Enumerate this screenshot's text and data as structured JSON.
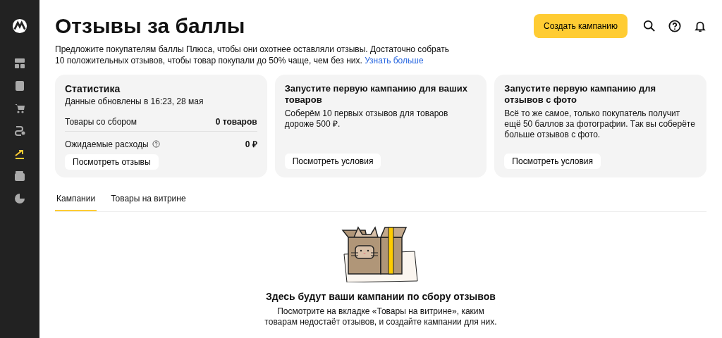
{
  "sidebar": {
    "items": [
      {
        "kind": "dashboard",
        "selected": false
      },
      {
        "kind": "box",
        "selected": false
      },
      {
        "kind": "cart",
        "selected": false
      },
      {
        "kind": "route",
        "selected": false
      },
      {
        "kind": "trend",
        "selected": true
      },
      {
        "kind": "wallet",
        "selected": false
      },
      {
        "kind": "pie",
        "selected": false
      }
    ]
  },
  "header": {
    "title": "Отзывы за баллы",
    "create_button": "Создать кампанию"
  },
  "intro": {
    "text": "Предложите покупателям баллы Плюса, чтобы они охотнее оставляли отзывы. Достаточно собрать 10 положительных отзывов, чтобы товар покупали до 50% чаще, чем без них.",
    "link": "Узнать больше"
  },
  "stats": {
    "title": "Статистика",
    "updated": "Данные обновлены в 16:23, 28 мая",
    "rows": [
      {
        "label": "Товары со сбором",
        "value": "0 товаров",
        "help": false
      },
      {
        "label": "Ожидаемые расходы",
        "value": "0 ₽",
        "help": true
      }
    ],
    "button": "Посмотреть отзывы"
  },
  "promos": [
    {
      "title": "Запустите первую кампанию для ваших товаров",
      "text": "Соберём 10 первых отзывов для товаров дороже 500 ₽.",
      "button": "Посмотреть условия"
    },
    {
      "title": "Запустите первую кампанию для отзывов с фото",
      "text": "Всё то же самое, только покупатель получит ещё 50 баллов за фотографии. Так вы соберёте больше отзывов с фото.",
      "button": "Посмотреть условия"
    }
  ],
  "tabs": [
    {
      "label": "Кампании",
      "selected": true
    },
    {
      "label": "Товары на витрине",
      "selected": false
    }
  ],
  "empty": {
    "title": "Здесь будут ваши кампании по сбору отзывов",
    "text": "Посмотрите на вкладке «Товары на витрине», каким товарам недостаёт отзывов, и создайте кампании для них."
  }
}
